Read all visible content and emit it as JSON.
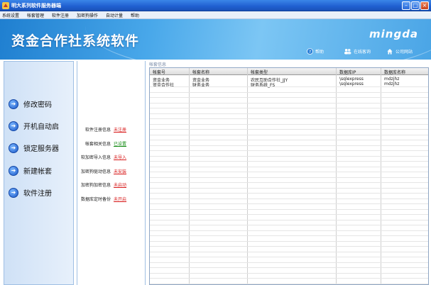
{
  "window": {
    "title": "明大系列软件服务器端"
  },
  "menu": [
    "系统设置",
    "帐套管理",
    "软件注册",
    "加密狗操作",
    "自动计量",
    "帮助"
  ],
  "banner": {
    "title": "资金合作社系统软件",
    "brand": "mingda",
    "links": [
      {
        "label": "帮助",
        "icon": "help-icon"
      },
      {
        "label": "在线客询",
        "icon": "people-icon"
      },
      {
        "label": "公司网站",
        "icon": "home-icon"
      }
    ]
  },
  "sidebar": {
    "items": [
      {
        "label": "修改密码",
        "icon": "arrow-right-icon"
      },
      {
        "label": "开机自动启",
        "icon": "arrow-right-icon"
      },
      {
        "label": "锁定服务器",
        "icon": "arrow-right-icon"
      },
      {
        "label": "新建帐套",
        "icon": "arrow-right-icon"
      },
      {
        "label": "软件注册",
        "icon": "arrow-right-icon"
      }
    ]
  },
  "info": {
    "rows": [
      {
        "label": "软件注册信息",
        "status": "未注册",
        "color": "#d81b1b"
      },
      {
        "label": "帐套相关信息",
        "status": "已设置",
        "color": "#138a13"
      },
      {
        "label": "软加密导入信息",
        "status": "未导入",
        "color": "#d81b1b"
      },
      {
        "label": "加密狗驱动信息",
        "status": "未安装",
        "color": "#d81b1b"
      },
      {
        "label": "加密狗加密信息",
        "status": "未启动",
        "color": "#d81b1b"
      },
      {
        "label": "数据库定时备份",
        "status": "未开启",
        "color": "#d81b1b"
      }
    ]
  },
  "accounts": {
    "group_label": "帐套信息",
    "columns": [
      "帐套号",
      "帐套名称",
      "帐套类型",
      "数据库IP",
      "数据库名称"
    ],
    "rows": [
      [
        "资金业务",
        "资金业务",
        "农民互助合作社_JJY",
        "\\sqlexpress",
        "mdzjhz"
      ],
      [
        "资金合作社",
        "财务业务",
        "财务系统_FS",
        "\\sqlexpress",
        "mdzjhz"
      ]
    ]
  }
}
